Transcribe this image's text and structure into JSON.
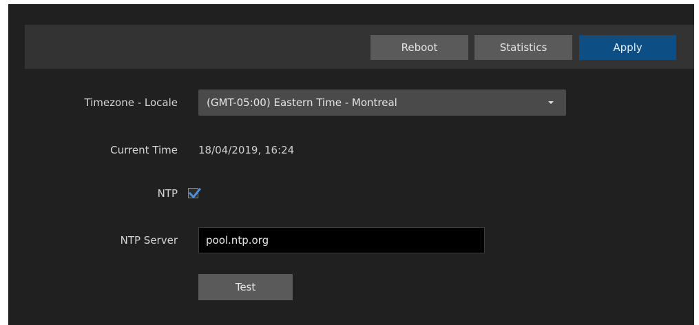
{
  "toolbar": {
    "reboot_label": "Reboot",
    "statistics_label": "Statistics",
    "apply_label": "Apply"
  },
  "form": {
    "timezone_label": "Timezone - Locale",
    "timezone_value": "(GMT-05:00) Eastern Time - Montreal",
    "current_time_label": "Current Time",
    "current_time_value": "18/04/2019, 16:24",
    "ntp_label": "NTP",
    "ntp_checked": true,
    "ntp_server_label": "NTP Server",
    "ntp_server_value": "pool.ntp.org",
    "test_label": "Test"
  },
  "colors": {
    "panel_bg": "#202020",
    "toolbar_bg": "#333333",
    "button_grey": "#5a5a5a",
    "button_primary": "#0d4f85",
    "checkbox_check": "#4a90d9"
  },
  "icons": {
    "dropdown": "caret-down-icon",
    "checkbox_mark": "checkmark-icon"
  }
}
